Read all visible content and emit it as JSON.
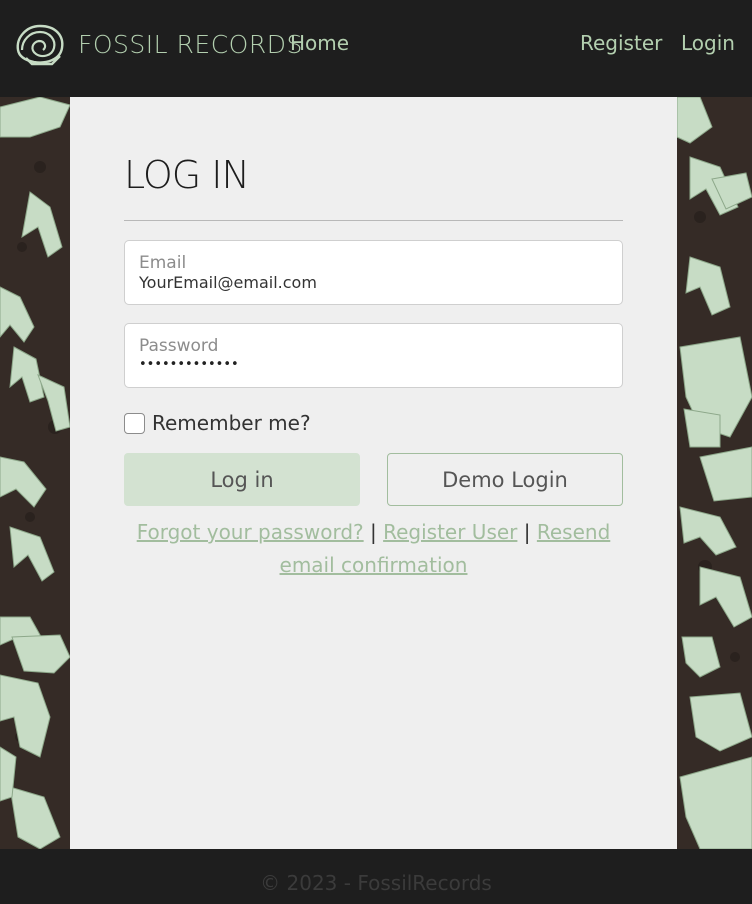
{
  "brand": {
    "name": "FOSSIL RECORDS",
    "logo_icon": "ammonite-fossil-icon"
  },
  "nav": {
    "home_label": "Home",
    "register_label": "Register",
    "login_label": "Login"
  },
  "login_form": {
    "title": "LOG IN",
    "email": {
      "label": "Email",
      "value": "YourEmail@email.com"
    },
    "password": {
      "label": "Password",
      "masked_value": "•••••••••••••"
    },
    "remember_label": "Remember me?",
    "login_button": "Log in",
    "demo_button": "Demo Login"
  },
  "links": {
    "forgot": "Forgot your password?",
    "separator": "|",
    "register": "Register User",
    "resend": "Resend email confirmation"
  },
  "footer": {
    "text": "© 2023 - FossilRecords"
  },
  "colors": {
    "accent": "#a2bd9e",
    "nav_text": "#b3cfaf",
    "header_bg": "#1e1e1e",
    "panel_bg": "#efefef",
    "button_fill": "#d3e2d1",
    "background_pattern": "#352b26",
    "bone": "#c7dcc5"
  }
}
